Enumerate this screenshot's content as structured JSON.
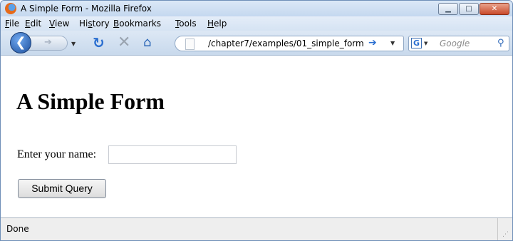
{
  "window": {
    "title": "A Simple Form - Mozilla Firefox"
  },
  "menu": {
    "items": [
      {
        "accel": "F",
        "rest": "ile"
      },
      {
        "accel": "E",
        "rest": "dit"
      },
      {
        "accel": "V",
        "rest": "iew"
      },
      {
        "pre": "Hi",
        "accel": "s",
        "rest": "tory"
      },
      {
        "accel": "B",
        "rest": "ookmarks"
      },
      {
        "accel": "T",
        "rest": "ools"
      },
      {
        "accel": "H",
        "rest": "elp"
      }
    ]
  },
  "nav": {
    "url": "/chapter7/examples/01_simple_form",
    "search_placeholder": "Google"
  },
  "page": {
    "heading": "A Simple Form",
    "name_label": "Enter your name:",
    "name_value": "",
    "submit_label": "Submit Query"
  },
  "status": {
    "text": "Done"
  },
  "colors": {
    "window_frame": "#d7e4f2",
    "accent": "#2a6ed0",
    "close_button": "#c94a2b"
  },
  "icons": [
    "firefox-logo-icon",
    "back-arrow-icon",
    "forward-arrow-icon",
    "reload-icon",
    "stop-icon",
    "home-icon",
    "page-icon",
    "go-arrow-icon",
    "search-engine-icon",
    "magnifier-icon",
    "resize-grip-icon"
  ]
}
